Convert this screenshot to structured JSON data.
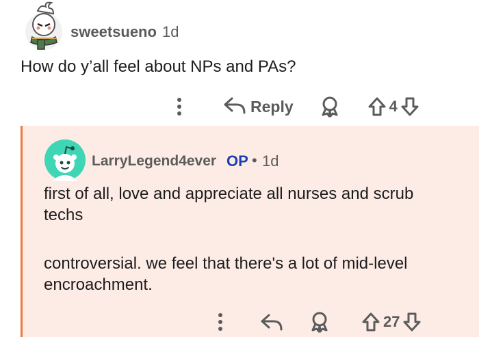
{
  "comment": {
    "username": "sweetsueno",
    "age": "1d",
    "text": "How do y’all feel about NPs and PAs?",
    "reply_label": "Reply",
    "vote_count": "4"
  },
  "reply": {
    "username": "LarryLegend4ever",
    "op_badge": "OP",
    "separator": "•",
    "age": "1d",
    "paragraphs": [
      "first of all, love and appreciate all nurses and scrub techs",
      "controversial. we feel that there's a lot of mid-level encroachment."
    ],
    "vote_count": "27"
  },
  "colors": {
    "reply_background": "#fdece6",
    "thread_line": "#f0773a",
    "op_badge": "#1a3fb3",
    "avatar2_bg": "#3ed6b4"
  },
  "icons": [
    "more-icon",
    "reply-icon",
    "award-icon",
    "upvote-icon",
    "downvote-icon"
  ]
}
